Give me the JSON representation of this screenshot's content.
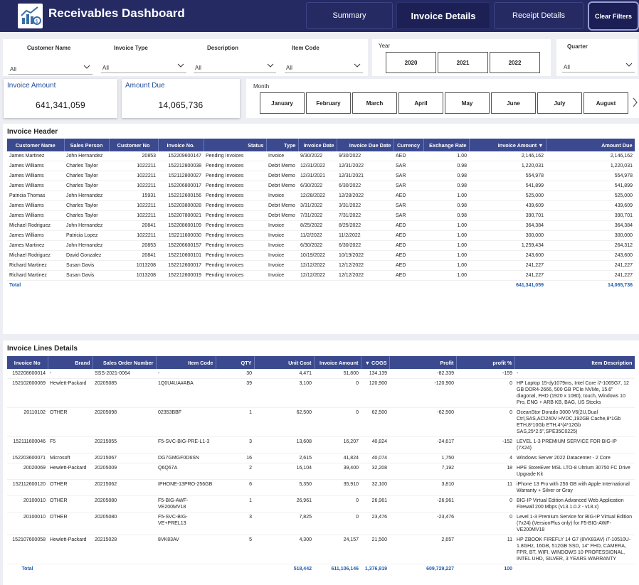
{
  "header": {
    "title": "Receivables Dashboard",
    "nav": [
      "Summary",
      "Invoice Details",
      "Receipt Details"
    ],
    "clear_filters": "Clear Filters"
  },
  "filters": {
    "customer_name": {
      "label": "Customer Name",
      "value": "All"
    },
    "invoice_type": {
      "label": "Invoice Type",
      "value": "All"
    },
    "description": {
      "label": "Description",
      "value": "All"
    },
    "item_code": {
      "label": "Item Code",
      "value": "All"
    },
    "year": {
      "label": "Year",
      "options": [
        "2020",
        "2021",
        "2022"
      ]
    },
    "quarter": {
      "label": "Quarter",
      "value": "All"
    },
    "month": {
      "label": "Month",
      "options": [
        "January",
        "February",
        "March",
        "April",
        "May",
        "June",
        "July",
        "August"
      ]
    }
  },
  "kpis": {
    "invoice_amount": {
      "label": "Invoice Amount",
      "value": "641,341,059"
    },
    "amount_due": {
      "label": "Amount Due",
      "value": "14,065,736"
    }
  },
  "invoice_header": {
    "title": "Invoice Header",
    "columns": [
      "Customer Name",
      "Sales Person",
      "Customer No",
      "Invoice No.",
      "Status",
      "Type",
      "Invoice Date",
      "Invoice Due Date",
      "Currency",
      "Exchange Rate",
      "Invoice Amount",
      "Amount Due"
    ],
    "rows": [
      [
        "James Martinez",
        "John Hernandez",
        "20853",
        "152209600147",
        "Pending Invoices",
        "Invoice",
        "9/30/2022",
        "9/30/2022",
        "AED",
        "1.00",
        "2,146,162",
        "2,146,162"
      ],
      [
        "James Williams",
        "Charles Taylor",
        "1022211",
        "152212800038",
        "Pending Invoices",
        "Debit Memo",
        "12/31/2022",
        "12/31/2022",
        "SAR",
        "0.98",
        "1,220,031",
        "1,220,031"
      ],
      [
        "James Williams",
        "Charles Taylor",
        "1022211",
        "152112800027",
        "Pending Invoices",
        "Debit Memo",
        "12/31/2021",
        "12/31/2021",
        "SAR",
        "0.98",
        "554,978",
        "554,978"
      ],
      [
        "James Williams",
        "Charles Taylor",
        "1022211",
        "152206800017",
        "Pending Invoices",
        "Debit Memo",
        "6/30/2022",
        "6/30/2022",
        "SAR",
        "0.98",
        "541,899",
        "541,899"
      ],
      [
        "Patricia Thomas",
        "John Hernandez",
        "15931",
        "152212600156",
        "Pending Invoices",
        "Invoice",
        "12/28/2022",
        "12/28/2022",
        "AED",
        "1.00",
        "525,000",
        "525,000"
      ],
      [
        "James Williams",
        "Charles Taylor",
        "1022211",
        "152203800028",
        "Pending Invoices",
        "Debit Memo",
        "3/31/2022",
        "3/31/2022",
        "SAR",
        "0.98",
        "439,609",
        "439,609"
      ],
      [
        "James Williams",
        "Charles Taylor",
        "1022211",
        "152207800021",
        "Pending Invoices",
        "Debit Memo",
        "7/31/2022",
        "7/31/2022",
        "SAR",
        "0.98",
        "390,701",
        "390,701"
      ],
      [
        "Michael Rodriguez",
        "John Hernandez",
        "20841",
        "152208600109",
        "Pending Invoices",
        "Invoice",
        "8/25/2022",
        "8/25/2022",
        "AED",
        "1.00",
        "364,384",
        "364,384"
      ],
      [
        "James Williams",
        "Patricia Lopez",
        "1022211",
        "152211600030",
        "Pending Invoices",
        "Invoice",
        "11/2/2022",
        "11/2/2022",
        "AED",
        "1.00",
        "300,000",
        "300,000"
      ],
      [
        "James Martinez",
        "John Hernandez",
        "20853",
        "152206600157",
        "Pending Invoices",
        "Invoice",
        "6/30/2022",
        "6/30/2022",
        "AED",
        "1.00",
        "1,259,434",
        "264,312"
      ],
      [
        "Michael Rodriguez",
        "David Gonzalez",
        "20841",
        "152210600101",
        "Pending Invoices",
        "Invoice",
        "10/19/2022",
        "10/19/2022",
        "AED",
        "1.00",
        "243,600",
        "243,600"
      ],
      [
        "Richard Martinez",
        "Susan Davis",
        "1013208",
        "152212600017",
        "Pending Invoices",
        "Invoice",
        "12/12/2022",
        "12/12/2022",
        "AED",
        "1.00",
        "241,227",
        "241,227"
      ],
      [
        "Richard Martinez",
        "Susan Davis",
        "1013208",
        "152212600019",
        "Pending Invoices",
        "Invoice",
        "12/12/2022",
        "12/12/2022",
        "AED",
        "1.00",
        "241,227",
        "241,227"
      ]
    ],
    "total": {
      "label": "Total",
      "invoice_amount": "641,341,059",
      "amount_due": "14,065,736"
    }
  },
  "invoice_lines": {
    "title": "Invoice Lines Details",
    "columns": [
      "Invoice No",
      "Brand",
      "Sales Order Number",
      "Item Code",
      "QTY",
      "Unit Cost",
      "Invoice Amount",
      "COGS",
      "Profit",
      "profit %",
      "Item Description"
    ],
    "rows": [
      [
        "152208600014",
        "-",
        "SSS-2021-0064",
        "-",
        "30",
        "4,471",
        "51,800",
        "134,139",
        "-82,339",
        "-159",
        "-"
      ],
      [
        "152102600069",
        "Hewlett-Packard",
        "20205085",
        "1Q0U4UA#ABA",
        "39",
        "3,100",
        "0",
        "120,900",
        "-120,900",
        "0",
        "HP Laptop 15-dy1079ms, Intel Core i7-1065G7, 12 GB DDR4-2666, 500 GB PCIe NVMe, 15.6\" diagonal, FHD (1920 x 1080), touch, Windows 10 Pro, ENG + ARB KB, BAG, US Stocks"
      ],
      [
        "20110102",
        "OTHER",
        "20205098",
        "02353BBF",
        "1",
        "62,500",
        "0",
        "62,500",
        "-62,500",
        "0",
        "OceanStor Dorado 3000 V6(2U,Dual Ctrl,SAS,AC\\240V HVDC,192GB Cache,8*1Gb ETH,8*10Gb ETH,4*(4*12Gb SAS,25*2.5\",SPE35C0225)"
      ],
      [
        "152111600046",
        "F5",
        "20215055",
        "F5-SVC-BIG-PRE-L1-3",
        "3",
        "13,608",
        "16,207",
        "40,824",
        "-24,617",
        "-152",
        "LEVEL 1-3 PREMIUM SERVICE FOR BIG-IP (7X24)"
      ],
      [
        "152203600071",
        "Microsoft",
        "20215067",
        "DG7GMGF0D6SN",
        "16",
        "2,615",
        "41,824",
        "40,074",
        "1,750",
        "4",
        "Windows Server 2022 Datacenter - 2 Core"
      ],
      [
        "20020069",
        "Hewlett-Packard",
        "20205009",
        "Q6Q67A",
        "2",
        "16,104",
        "39,400",
        "32,208",
        "7,192",
        "18",
        "HPE StoreEver MSL LTO-8 Ultrium 30750 FC Drive Upgrade Kit"
      ],
      [
        "152112600120",
        "OTHER",
        "20215062",
        "IPHONE-13PRO-256GB",
        "6",
        "5,350",
        "35,910",
        "32,100",
        "3,810",
        "11",
        "iPhone 13 Pro with 256 GB with Apple International Warranty + Silver or Gray"
      ],
      [
        "20100010",
        "OTHER",
        "20205080",
        "F5-BIG-AWF-VE200MV18",
        "1",
        "26,961",
        "0",
        "26,961",
        "-26,961",
        "0",
        "BIG-IP Virtual Edition Advanced Web Application Firewall 200 Mbps (v13.1.0.2 - v18.x)"
      ],
      [
        "20100010",
        "OTHER",
        "20205080",
        "F5-SVC-BIG-VE+PREL13",
        "3",
        "7,825",
        "0",
        "23,476",
        "-23,476",
        "0",
        "Level 1-3 Premium Service for BIG-IP Virtual Edition (7x24) (VersionPlus only) for F5-BIG-AWF-VE200MV18"
      ],
      [
        "152107600058",
        "Hewlett-Packard",
        "20215028",
        "8VK83AV",
        "5",
        "4,300",
        "24,157",
        "21,500",
        "2,657",
        "11",
        "HP ZBOOK FIREFLY 14 G7 (8VK83AV) i7-10510U-1.8GHz, 16GB, 512GB SSD, 14\" FHD, CAMERA, FPR, BT, WIFI, WINDOWS 10 PROFESSIONAL, INTEL UHD, SILVER, 3 YEARS WARRANTY"
      ]
    ],
    "total": {
      "label": "Total",
      "unit_cost": "518,442",
      "invoice_amount": "611,106,146",
      "cogs": "1,376,919",
      "profit": "609,729,227",
      "profit_pct": "100"
    }
  },
  "colors": {
    "header_bg": "#252a63",
    "table_header": "#3b4a8f",
    "accent_text": "#1f5fb0"
  }
}
